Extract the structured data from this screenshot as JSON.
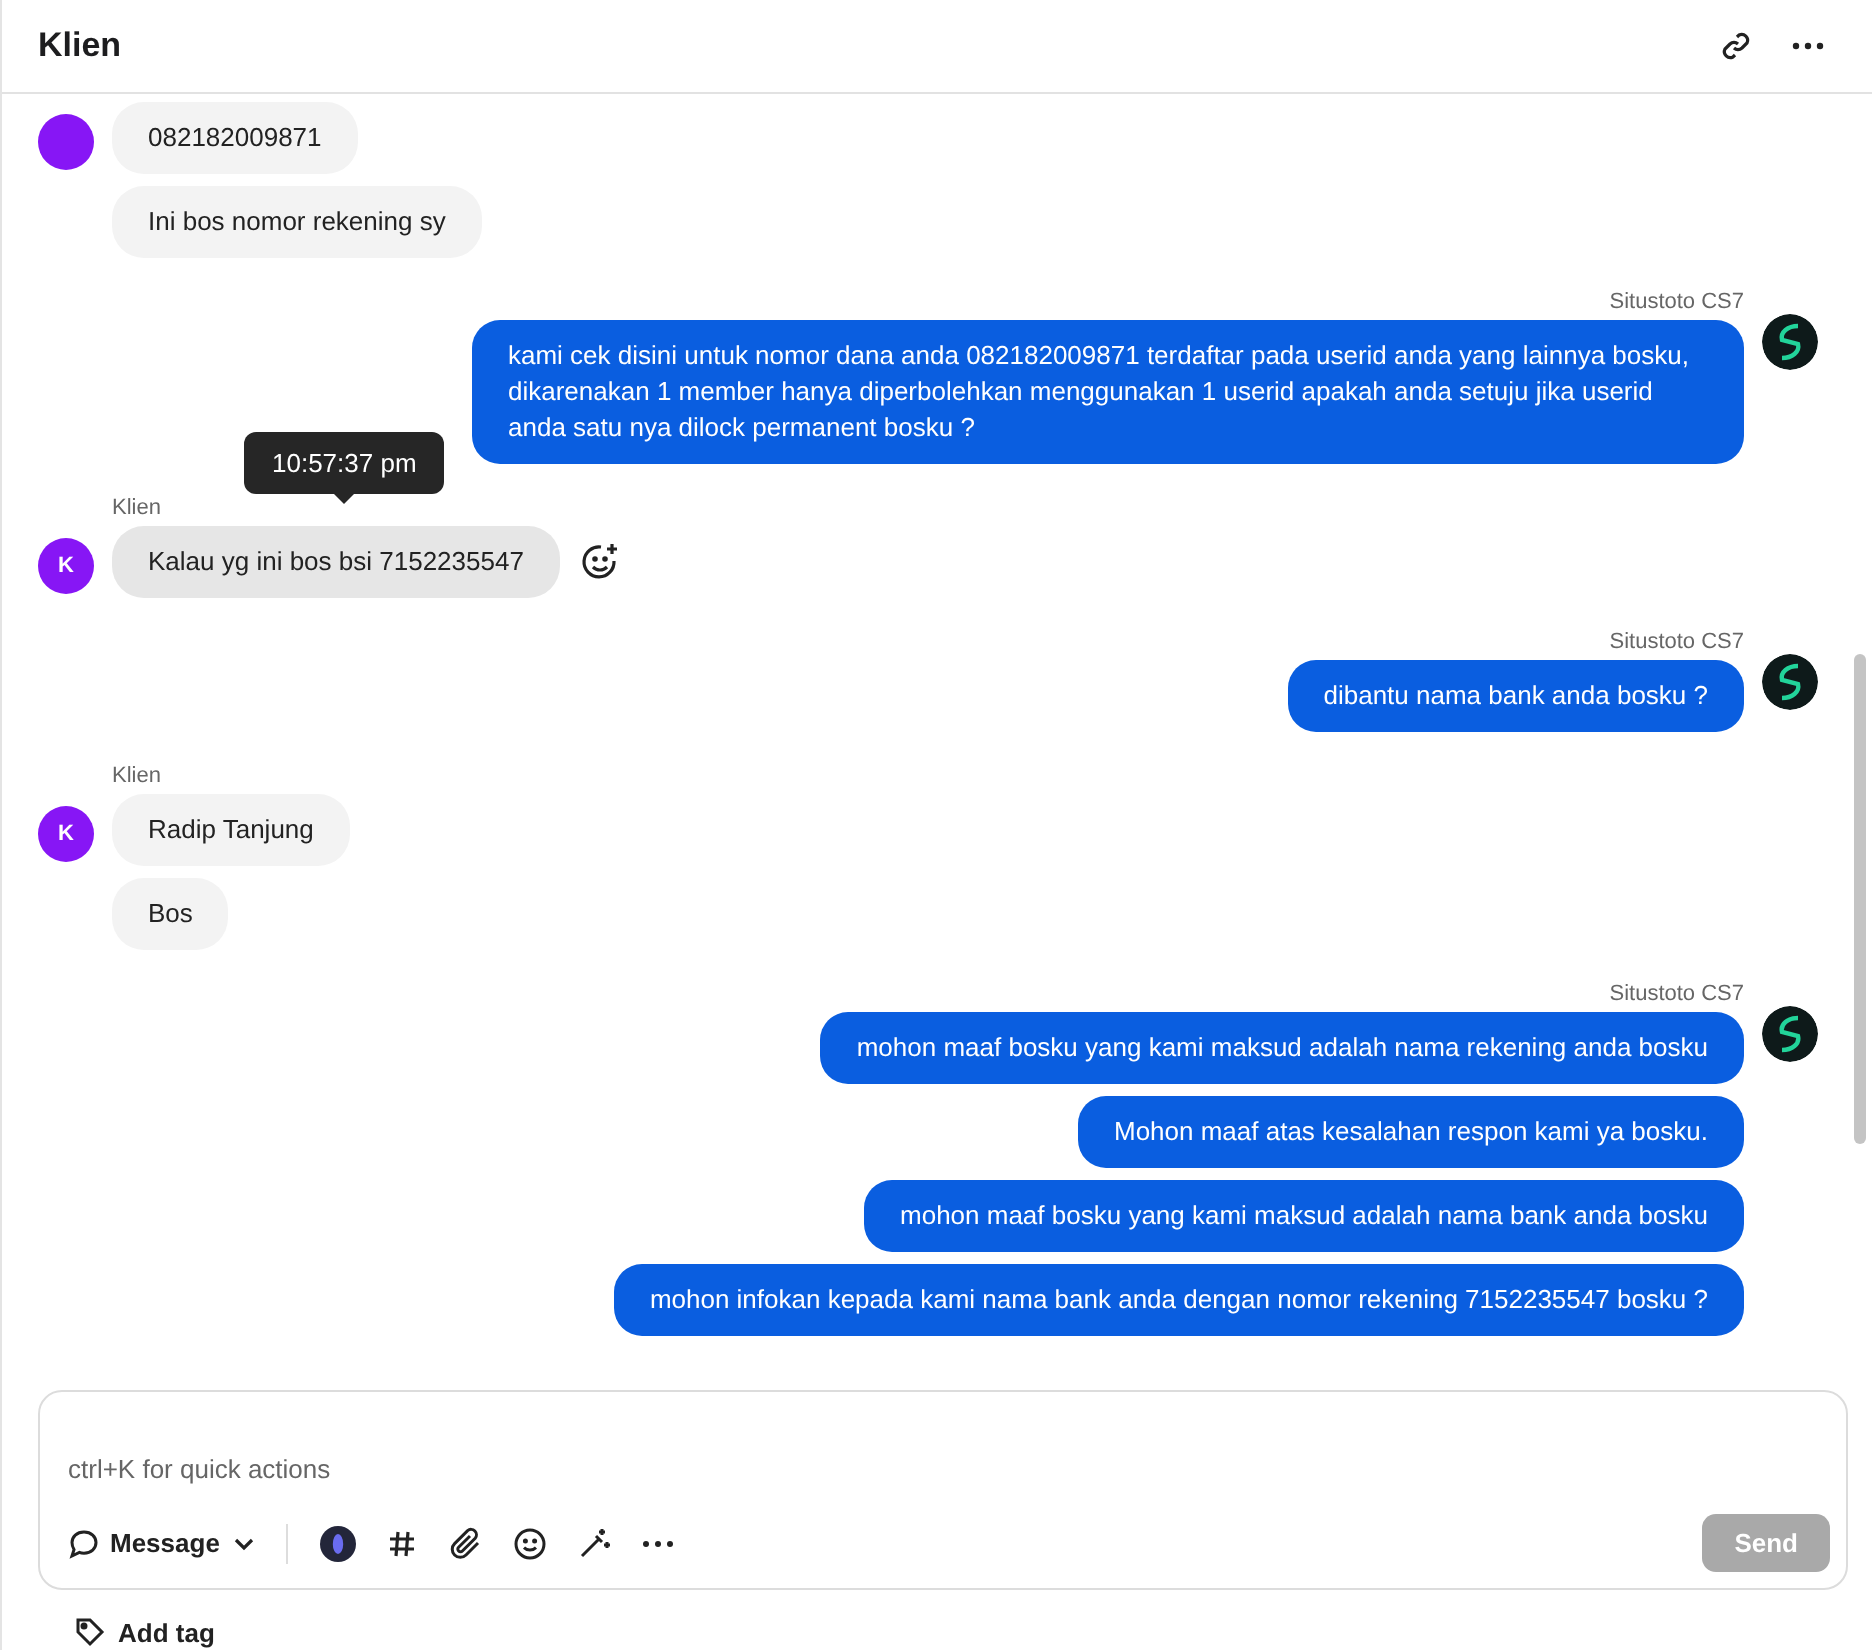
{
  "header": {
    "title": "Klien"
  },
  "groups": [
    {
      "kind": "client",
      "messages": [
        {
          "text": "082182009871",
          "hovered": false
        },
        {
          "text": "Ini bos nomor rekening sy",
          "hovered": false
        }
      ]
    },
    {
      "kind": "agent",
      "sender": "Situstoto CS7",
      "messages": [
        {
          "text": "kami cek disini untuk nomor dana anda 082182009871 terdaftar pada userid anda yang lainnya bosku, dikarenakan 1 member hanya diperbolehkan menggunakan 1 userid apakah anda setuju jika userid anda satu nya dilock permanent bosku ?"
        }
      ]
    },
    {
      "kind": "client",
      "sender": "Klien",
      "avatar": "K",
      "messages": [
        {
          "text": "Kalau yg ini bos bsi 7152235547",
          "hovered": true,
          "tooltip": "10:57:37 pm"
        }
      ]
    },
    {
      "kind": "agent",
      "sender": "Situstoto CS7",
      "messages": [
        {
          "text": "dibantu nama bank anda bosku ?"
        }
      ]
    },
    {
      "kind": "client",
      "sender": "Klien",
      "avatar": "K",
      "messages": [
        {
          "text": "Radip Tanjung",
          "hovered": false
        },
        {
          "text": "Bos",
          "hovered": false
        }
      ]
    },
    {
      "kind": "agent",
      "sender": "Situstoto CS7",
      "messages": [
        {
          "text": "mohon maaf bosku yang kami maksud adalah nama rekening anda bosku"
        },
        {
          "text": "Mohon maaf atas kesalahan respon kami ya bosku."
        },
        {
          "text": "mohon maaf bosku yang kami maksud adalah nama bank anda bosku"
        },
        {
          "text": "mohon infokan kepada kami nama bank anda dengan nomor rekening 7152235547 bosku ?"
        }
      ]
    }
  ],
  "composer": {
    "placeholder": "ctrl+K for quick actions",
    "mode": "Message",
    "send": "Send",
    "send_disabled": true
  },
  "add_tag": "Add tag"
}
